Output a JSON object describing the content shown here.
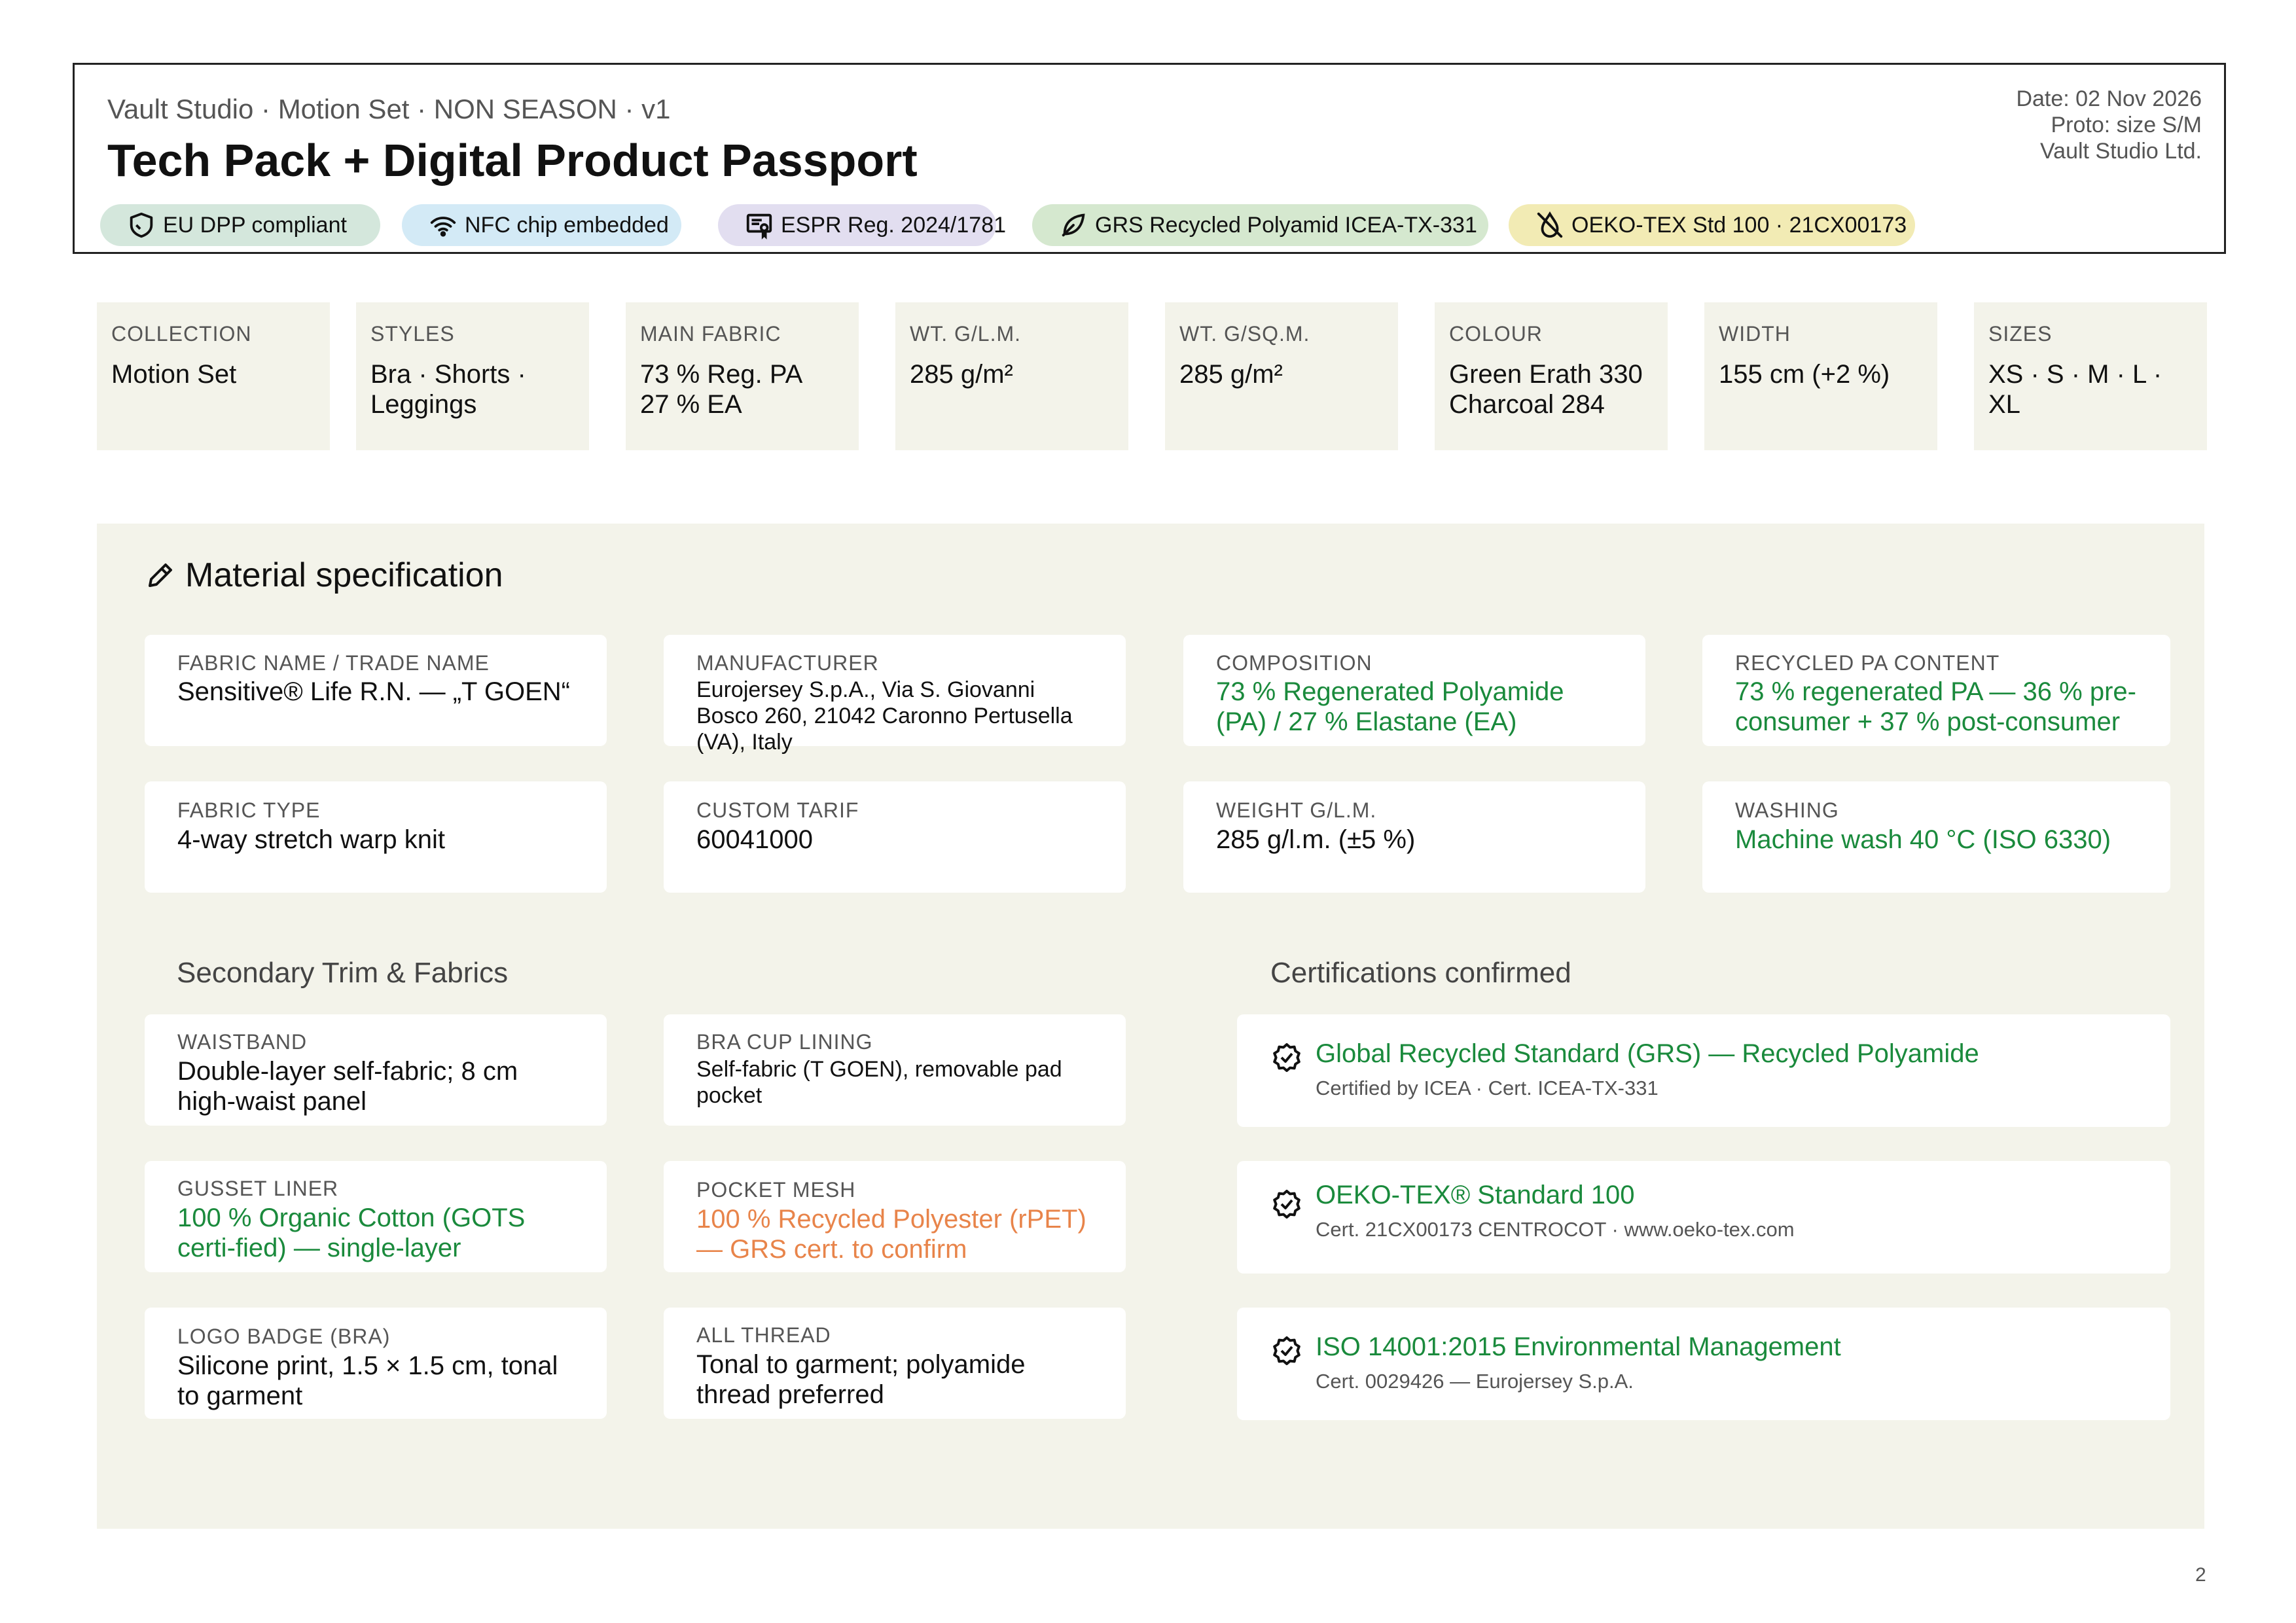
{
  "header": {
    "subtitle": "Vault Studio · Motion Set · NON SEASON · v1",
    "title": "Tech Pack + Digital Product Passport",
    "date": "Date: 02 Nov 2026",
    "proto": "Proto: size S/M",
    "company": "Vault Studio Ltd.",
    "badges": [
      {
        "label": "EU DPP compliant",
        "icon": "shield-icon",
        "color": "#d4e7dc"
      },
      {
        "label": "NFC chip embedded",
        "icon": "wifi-icon",
        "color": "#d3eaf6"
      },
      {
        "label": "ESPR Reg. 2024/1781",
        "icon": "certificate-icon",
        "color": "#e2def0"
      },
      {
        "label": "GRS Recycled Polyamid ICEA-TX-331",
        "icon": "leaf-icon",
        "color": "#d5e8cf"
      },
      {
        "label": "OEKO-TEX Std 100 · 21CX00173",
        "icon": "no-drop-icon",
        "color": "#f2ebb4"
      }
    ]
  },
  "specs": [
    {
      "label": "COLLECTION",
      "value": "Motion Set"
    },
    {
      "label": "STYLES",
      "value": "Bra · Shorts · Leggings"
    },
    {
      "label": "MAIN FABRIC",
      "value": "73 % Reg. PA 27 % EA"
    },
    {
      "label": "WT. G/L.M.",
      "value": "285 g/m²"
    },
    {
      "label": "WT. G/SQ.M.",
      "value": "285 g/m²"
    },
    {
      "label": "COLOUR",
      "value": "Green Erath 330 Charcoal 284"
    },
    {
      "label": "WIDTH",
      "value": "155 cm (+2 %)"
    },
    {
      "label": "SIZES",
      "value": "XS · S · M · L · XL"
    }
  ],
  "material": {
    "title": "Material specification",
    "cards": [
      {
        "label": "FABRIC NAME / TRADE NAME",
        "value": "Sensitive® Life R.N. — „T GOEN“"
      },
      {
        "label": "MANUFACTURER",
        "value": "Eurojersey S.p.A., Via S. Giovanni Bosco 260, 21042 Caronno Pertusella (VA), Italy"
      },
      {
        "label": "COMPOSITION",
        "value": "73 % Regenerated Polyamide (PA) / 27 % Elastane (EA)"
      },
      {
        "label": "RECYCLED PA CONTENT",
        "value": "73 % regenerated PA — 36 % pre-consumer + 37 % post-consumer"
      },
      {
        "label": "FABRIC TYPE",
        "value": "4-way stretch warp knit"
      },
      {
        "label": "CUSTOM TARIF",
        "value": "60041000"
      },
      {
        "label": "WEIGHT G/L.M.",
        "value": "285 g/l.m. (±5 %)"
      },
      {
        "label": "WASHING",
        "value": "Machine wash 40 °C (ISO 6330)"
      }
    ],
    "trims_title": "Secondary Trim & Fabrics",
    "trims": [
      {
        "label": "WAISTBAND",
        "value": "Double-layer self-fabric; 8 cm high-waist panel"
      },
      {
        "label": "BRA CUP LINING",
        "value": "Self-fabric (T GOEN), removable pad pocket"
      },
      {
        "label": "GUSSET LINER",
        "value": "100 % Organic Cotton (GOTS certi-fied) — single-layer"
      },
      {
        "label": "POCKET MESH",
        "value": "100 % Recycled Polyester (rPET) — GRS cert. to confirm"
      },
      {
        "label": "LOGO BADGE (BRA)",
        "value": "Silicone print, 1.5 × 1.5 cm, tonal to garment"
      },
      {
        "label": "ALL THREAD",
        "value": "Tonal to garment; polyamide thread preferred"
      }
    ],
    "certs_title": "Certifications confirmed",
    "certs": [
      {
        "title": "Global Recycled Standard (GRS) — Recycled Polyamide",
        "sub": "Certified by ICEA · Cert. ICEA-TX-331"
      },
      {
        "title": "OEKO-TEX® Standard 100",
        "sub": "Cert. 21CX00173 CENTROCOT · www.oeko-tex.com"
      },
      {
        "title": "ISO 14001:2015 Environmental Management",
        "sub": "Cert. 0029426 — Eurojersey S.p.A."
      }
    ]
  },
  "page_number": "2",
  "colors": {
    "accent_green": "#1a8a3c",
    "warning_orange": "#e8844a",
    "panel_bg": "#f3f3ea"
  }
}
